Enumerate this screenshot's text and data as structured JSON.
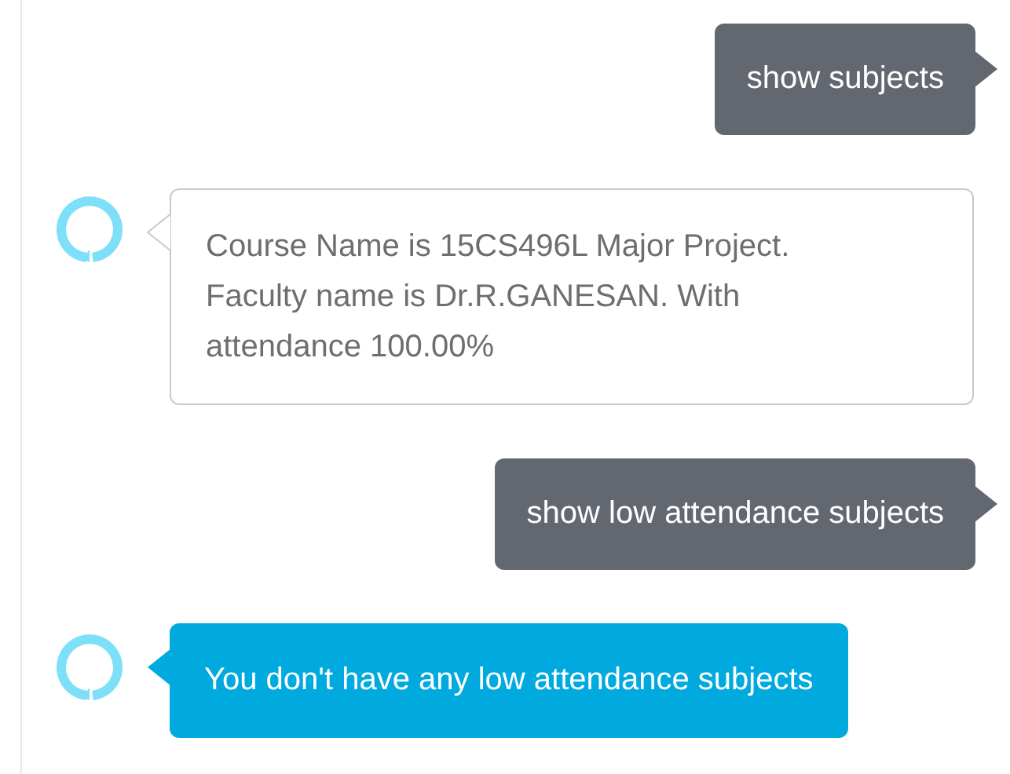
{
  "messages": [
    {
      "kind": "sent",
      "text": "show subjects"
    },
    {
      "kind": "received",
      "text": "Course Name is 15CS496L Major Project. Faculty name is Dr.R.GANESAN. With attendance 100.00%"
    },
    {
      "kind": "sent",
      "text": "show low attendance subjects"
    },
    {
      "kind": "highlighted",
      "text": "You don't have any low attendance subjects"
    }
  ]
}
